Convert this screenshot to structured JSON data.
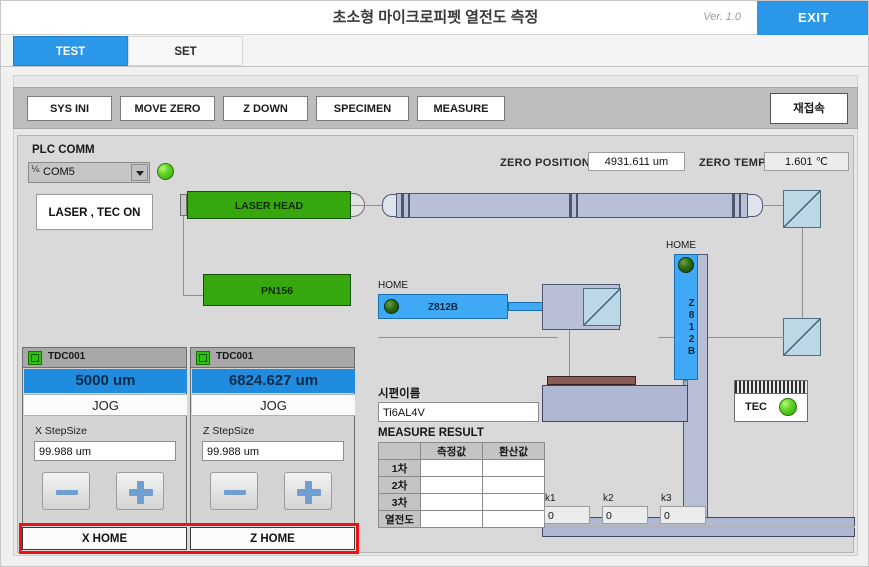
{
  "window": {
    "title": "초소형 마이크로피펫 열전도 측정",
    "version": "Ver. 1.0",
    "exit_label": "EXIT"
  },
  "tabs": [
    {
      "label": "TEST",
      "active": true
    },
    {
      "label": "SET",
      "active": false
    }
  ],
  "toolbar": {
    "buttons": [
      {
        "label": "SYS INI"
      },
      {
        "label": "MOVE ZERO"
      },
      {
        "label": "Z DOWN"
      },
      {
        "label": "SPECIMEN"
      },
      {
        "label": "MEASURE"
      }
    ],
    "reconnect_label": "재접속"
  },
  "plc": {
    "label": "PLC COMM",
    "port": "COM5",
    "status_led": "green",
    "laser_tec_label": "LASER , TEC ON"
  },
  "zero": {
    "position_label": "ZERO POSITION",
    "position_value": "4931.611 um",
    "temp_label": "ZERO TEMP",
    "temp_value": "1.601 ℃"
  },
  "diagram": {
    "laser_head": "LASER HEAD",
    "pn156": "PN156",
    "z812b_h": "Z812B",
    "z812b_v": "Z812B",
    "home_label_h": "HOME",
    "home_label_v": "HOME",
    "tec_label": "TEC"
  },
  "motors": [
    {
      "title": "TDC001",
      "readout": "5000 um",
      "jog": "JOG",
      "step_label": "X StepSize",
      "step_value": "99.988 um",
      "minus": "-",
      "plus": "+",
      "home": "X HOME"
    },
    {
      "title": "TDC001",
      "readout": "6824.627 um",
      "jog": "JOG",
      "step_label": "Z StepSize",
      "step_value": "99.988 um",
      "minus": "-",
      "plus": "+",
      "home": "Z HOME"
    }
  ],
  "measure": {
    "specimen_label": "시편이름",
    "specimen_value": "Ti6AL4V",
    "result_label": "MEASURE RESULT",
    "columns": [
      "",
      "측정값",
      "환산값"
    ],
    "rows": [
      {
        "name": "1차",
        "measured": "",
        "converted": ""
      },
      {
        "name": "2차",
        "measured": "",
        "converted": ""
      },
      {
        "name": "3차",
        "measured": "",
        "converted": ""
      },
      {
        "name": "열전도",
        "measured": "",
        "converted": ""
      }
    ],
    "k_fields": [
      {
        "label": "k1",
        "value": "0"
      },
      {
        "label": "k2",
        "value": "0"
      },
      {
        "label": "k3",
        "value": "0"
      }
    ]
  },
  "colors": {
    "accent_blue": "#2a97e8",
    "readout_blue": "#1f8ce0",
    "green_box": "#36a80e",
    "blue_box": "#3fa9f5",
    "annotation_red": "#ef1111"
  }
}
